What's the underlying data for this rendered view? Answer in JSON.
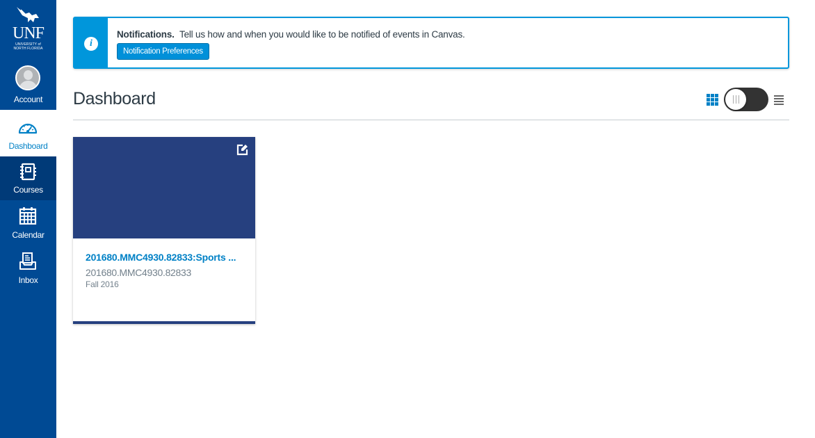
{
  "sidebar": {
    "logo": {
      "name": "UNF",
      "subtitle_line1": "UNIVERSITY of",
      "subtitle_line2": "NORTH FLORIDA"
    },
    "items": [
      {
        "label": "Account",
        "icon": "avatar-icon",
        "active": false
      },
      {
        "label": "Dashboard",
        "icon": "dashboard-gauge-icon",
        "active": true
      },
      {
        "label": "Courses",
        "icon": "courses-notebook-icon",
        "active": false
      },
      {
        "label": "Calendar",
        "icon": "calendar-icon",
        "active": false
      },
      {
        "label": "Inbox",
        "icon": "inbox-icon",
        "active": false
      }
    ],
    "colors": {
      "background": "#004a94",
      "active_bg": "#ffffff",
      "active_text": "#0081c6"
    }
  },
  "notification": {
    "title": "Notifications.",
    "message": "Tell us how and when you would like to be notified of events in Canvas.",
    "button_label": "Notification Preferences",
    "icon": "info-icon",
    "accent": "#0096db"
  },
  "dashboard": {
    "title": "Dashboard",
    "view_toggle": {
      "left_icon": "grid-icon",
      "right_icon": "list-icon",
      "selected": "card-view"
    }
  },
  "courses": [
    {
      "title": "201680.MMC4930.82833:Sports ...",
      "code": "201680.MMC4930.82833",
      "term": "Fall 2016",
      "color": "#26407f"
    }
  ]
}
